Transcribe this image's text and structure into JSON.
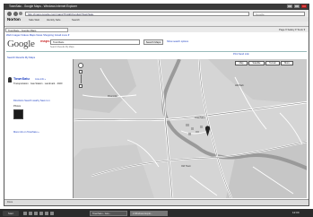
{
  "window": {
    "title": "TownSatu - Google Maps - Windows Internet Explorer"
  },
  "browser": {
    "address": "http://maps.google.com/maps?f=q&hl=en&q=TownSatu",
    "search_placeholder": "Google",
    "toolbar_items": [
      "Norton",
      "Safe Web",
      "Identity Safe",
      "Search"
    ],
    "tab_title": "TownSatu - Google Maps",
    "command_bar": "Page ▾  Safety ▾  Tools ▾"
  },
  "google": {
    "nav_links": "Web  Images  Videos  Maps  News  Shopping  Gmail  more ▾",
    "logo_text": "Google",
    "logo_maps": "maps",
    "search_value": "TownSatu",
    "search_button": "Search Maps",
    "search_options": "Show search options",
    "sub_line": "Search Results  My Maps",
    "top_links": "Print  Send  Link"
  },
  "left_panel": {
    "tabs": "Search Results  My Maps",
    "result_title": "TownSatu",
    "result_badge": "more info »",
    "result_text": "Transportation  ·  Gas Station  ·  Landmark  ·  2020",
    "directions": "Directions  Search nearby  Save to ▾",
    "photos_label": "Photos",
    "more_link": "More info on TownSatu »"
  },
  "map": {
    "types": [
      "Map",
      "Satellite",
      "Terrain",
      "More"
    ],
    "labels": [
      "TownSatu",
      "Riverside",
      "Hill Park",
      "Old Town"
    ]
  },
  "status": {
    "text": "Done"
  },
  "taskbar": {
    "start_label": "Start",
    "items": [
      "TownSatu - Goo...",
      "2 Windows Explo..."
    ],
    "clock": "12:00"
  }
}
